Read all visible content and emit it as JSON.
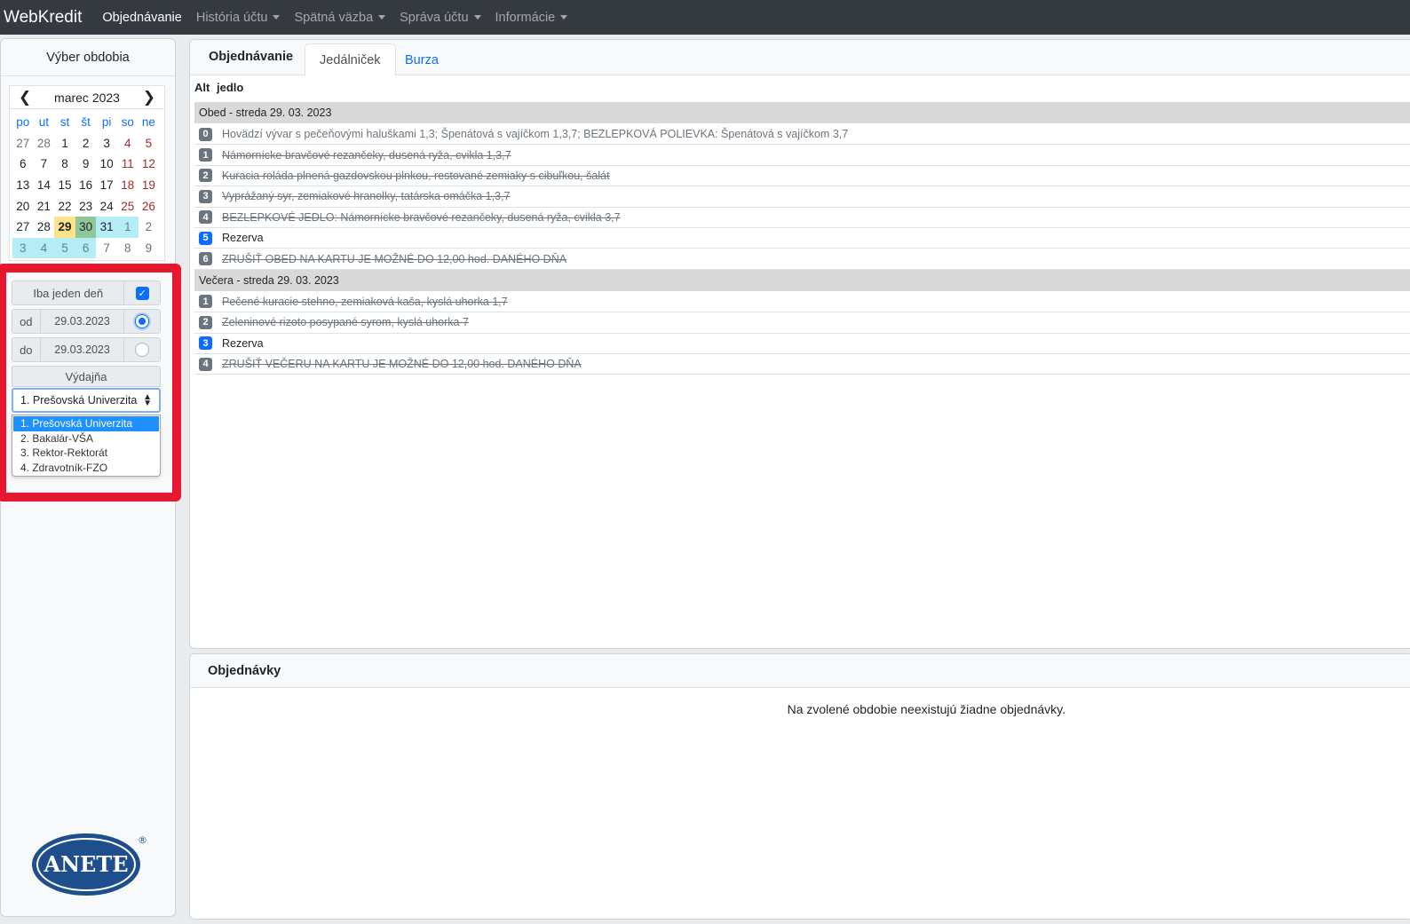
{
  "nav": {
    "brand": "WebKredit",
    "items": [
      {
        "label": "Objednávanie",
        "active": true,
        "dropdown": false
      },
      {
        "label": "História účtu",
        "active": false,
        "dropdown": true
      },
      {
        "label": "Spätná väzba",
        "active": false,
        "dropdown": true
      },
      {
        "label": "Správa účtu",
        "active": false,
        "dropdown": true
      },
      {
        "label": "Informácie",
        "active": false,
        "dropdown": true
      }
    ]
  },
  "sidebar": {
    "title": "Výber obdobia",
    "calendar": {
      "month_label": "marec 2023",
      "weekdays": [
        "po",
        "ut",
        "st",
        "št",
        "pi",
        "so",
        "ne"
      ],
      "weeks": [
        [
          "27",
          "28",
          "1",
          "2",
          "3",
          "4",
          "5"
        ],
        [
          "6",
          "7",
          "8",
          "9",
          "10",
          "11",
          "12"
        ],
        [
          "13",
          "14",
          "15",
          "16",
          "17",
          "18",
          "19"
        ],
        [
          "20",
          "21",
          "22",
          "23",
          "24",
          "25",
          "26"
        ],
        [
          "27",
          "28",
          "29",
          "30",
          "31",
          "1",
          "2"
        ],
        [
          "3",
          "4",
          "5",
          "6",
          "7",
          "8",
          "9"
        ]
      ]
    },
    "one_day_label": "Iba jeden deň",
    "from_label": "od",
    "from_value": "29.03.2023",
    "to_label": "do",
    "to_value": "29.03.2023",
    "vydajna_label": "Výdajňa",
    "vydajna_selected": "1. Prešovská Univerzita",
    "vydajna_options": [
      "1. Prešovská Univerzita",
      "2. Bakalár-VŠA",
      "3. Rektor-Rektorát",
      "4. Zdravotník-FZO"
    ],
    "logo_text": "ANETE",
    "logo_mark": "®"
  },
  "main": {
    "tabs": [
      "Objednávanie",
      "Jedálniček",
      "Burza"
    ],
    "col_alt": "Alt",
    "col_jedlo": "jedlo",
    "groups": [
      {
        "title": "Obed - streda 29. 03. 2023",
        "items": [
          {
            "alt": "0",
            "text": "Hovädzí vývar s pečeňovými haluškami 1,3; Špenátová s vajíčkom 1,3,7; BEZLEPKOVÁ POLIEVKA: Špenátová s vajíčkom 3,7",
            "state": "normal"
          },
          {
            "alt": "1",
            "text": "Námornícke bravčové rezančeky, dusená ryža, cvikla 1,3,7",
            "state": "strike"
          },
          {
            "alt": "2",
            "text": "Kuracia roláda plnená gazdovskou plnkou, restované zemiaky s cibuľkou, šalát",
            "state": "strike"
          },
          {
            "alt": "3",
            "text": "Vyprážaný syr, zemiakové hranolky, tatárska omáčka 1,3,7",
            "state": "strike"
          },
          {
            "alt": "4",
            "text": "BEZLEPKOVÉ JEDLO: Námornícke bravčové rezančeky, dusená ryža, cvikla 3,7",
            "state": "strike"
          },
          {
            "alt": "5",
            "text": "Rezerva",
            "state": "reserve"
          },
          {
            "alt": "6",
            "text": "ZRUŠIŤ OBED NA KARTU JE MOŽNÉ DO 12,00 hod. DANÉHO DŇA",
            "state": "strike"
          }
        ]
      },
      {
        "title": "Večera - streda 29. 03. 2023",
        "items": [
          {
            "alt": "1",
            "text": "Pečené kuracie stehno, zemiaková kaša, kyslá uhorka 1,7",
            "state": "strike"
          },
          {
            "alt": "2",
            "text": "Zeleninové rizoto posypané syrom, kyslá uhorka 7",
            "state": "strike"
          },
          {
            "alt": "3",
            "text": "Rezerva",
            "state": "reserve"
          },
          {
            "alt": "4",
            "text": "ZRUŠIŤ VEČERU NA KARTU JE MOŽNÉ DO 12,00 hod. DANÉHO DŇA",
            "state": "strike"
          }
        ]
      }
    ]
  },
  "orders": {
    "title": "Objednávky",
    "empty_text": "Na zvolené obdobie neexistujú žiadne objednávky."
  },
  "colors": {
    "navbar": "#343a40",
    "accent": "#0d6efd",
    "today": "#ffe28a",
    "selected_day": "#8fc79a",
    "range": "#b6ecf5",
    "highlight_box": "#e8162f"
  }
}
